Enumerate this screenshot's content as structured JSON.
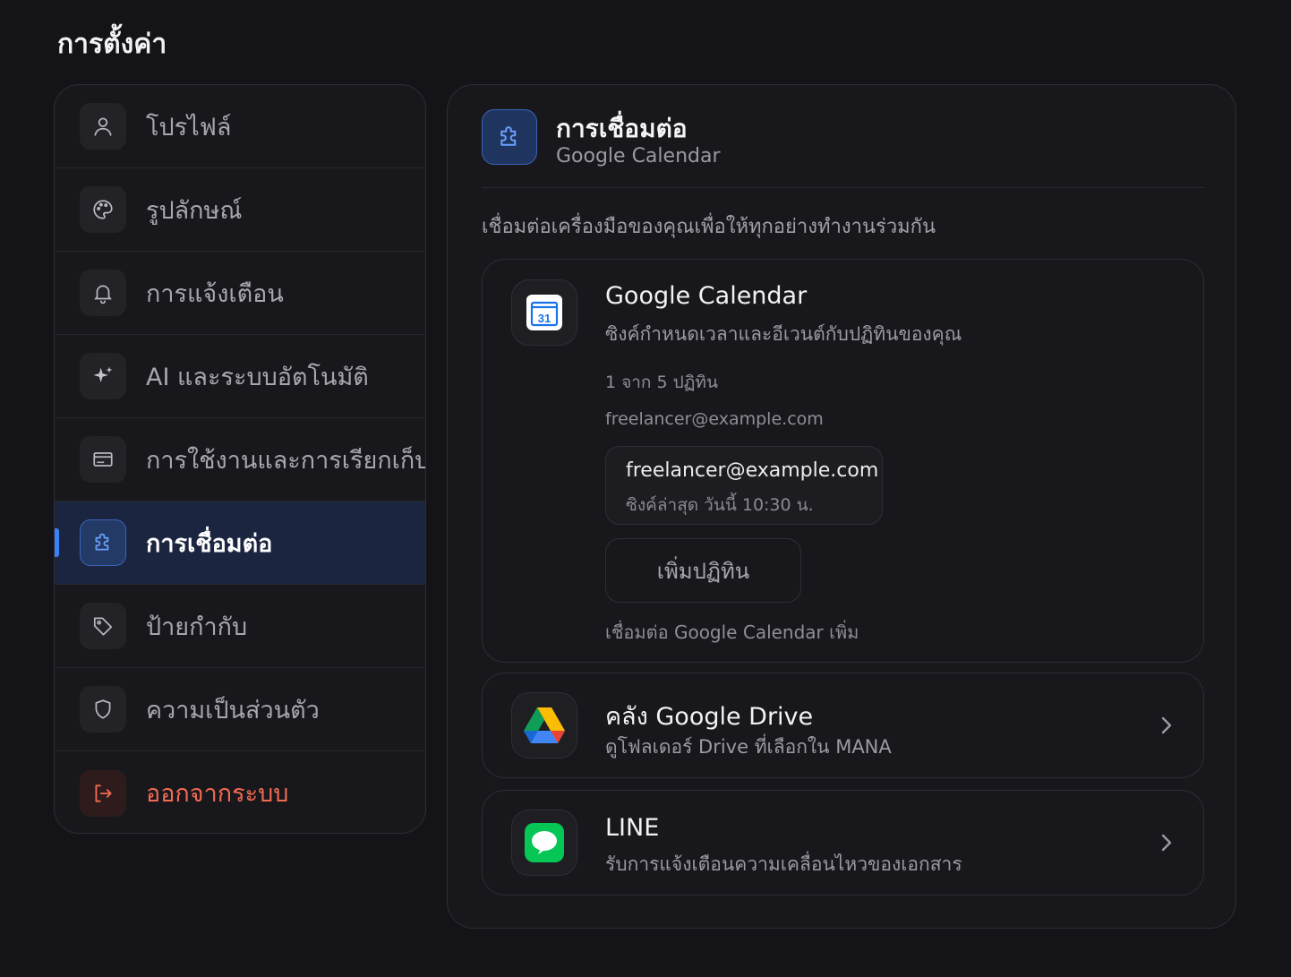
{
  "page": {
    "title": "การตั้งค่า"
  },
  "sidebar": {
    "items": [
      {
        "label": "โปรไฟล์",
        "icon": "user-icon",
        "active": false
      },
      {
        "label": "รูปลักษณ์",
        "icon": "palette-icon",
        "active": false
      },
      {
        "label": "การแจ้งเตือน",
        "icon": "bell-icon",
        "active": false
      },
      {
        "label": "AI และระบบอัตโนมัติ",
        "icon": "sparkle-icon",
        "active": false
      },
      {
        "label": "การใช้งานและการเรียกเก็บเงิน",
        "icon": "card-icon",
        "active": false
      },
      {
        "label": "การเชื่อมต่อ",
        "icon": "puzzle-icon",
        "active": true
      },
      {
        "label": "ป้ายกำกับ",
        "icon": "tag-icon",
        "active": false
      },
      {
        "label": "ความเป็นส่วนตัว",
        "icon": "shield-icon",
        "active": false
      },
      {
        "label": "ออกจากระบบ",
        "icon": "logout-icon",
        "active": false
      }
    ]
  },
  "panel": {
    "title": "การเชื่อมต่อ",
    "subtitle": "Google Calendar",
    "description": "เชื่อมต่อเครื่องมือของคุณเพื่อให้ทุกอย่างทำงานร่วมกัน",
    "header_icon": "puzzle-icon"
  },
  "google_calendar": {
    "icon": "google-calendar-icon",
    "title": "Google Calendar",
    "subtitle": "ซิงค์กำหนดเวลาและอีเวนต์กับปฏิทินของคุณ",
    "calendar_count": "1 จาก 5 ปฏิทิน",
    "account": "freelancer@example.com",
    "calendar": {
      "email": "freelancer@example.com",
      "last_sync": "ซิงค์ล่าสุด วันนี้ 10:30 น."
    },
    "add_button": "เพิ่มปฏิทิน",
    "footer": "เชื่อมต่อ Google Calendar เพิ่ม"
  },
  "google_drive": {
    "icon": "google-drive-icon",
    "title": "คลัง Google Drive",
    "subtitle": "ดูโฟลเดอร์ Drive ที่เลือกใน MANA"
  },
  "line": {
    "icon": "line-chat-icon",
    "title": "LINE",
    "subtitle": "รับการแจ้งเตือนความเคลื่อนไหวของเอกสาร"
  },
  "colors": {
    "background": "#141418",
    "accent": "#3b82f6",
    "danger": "#f26a52",
    "line_green": "#06c755"
  }
}
